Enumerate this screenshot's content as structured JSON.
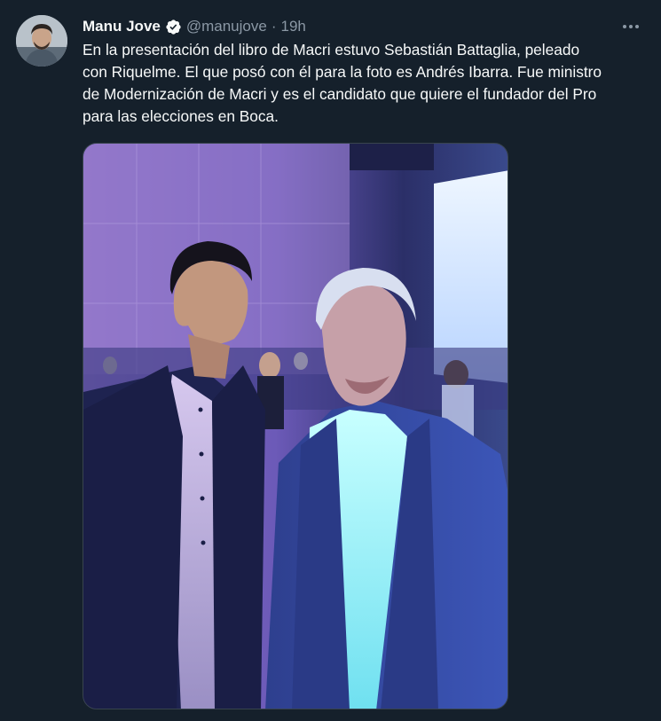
{
  "tweet": {
    "author_name": "Manu Jove",
    "verified": true,
    "handle": "@manujove",
    "separator": "·",
    "time": "19h",
    "text": "En la presentación del libro de Macri estuvo Sebastián Battaglia, peleado\ncon Riquelme. El que posó con él para la foto es Andrés Ibarra. Fue ministro\nde Modernización de Macri y es el candidato que quiere el fundador del Pro\npara las elecciones en Boca.",
    "more_icon": "more-horizontal-icon"
  },
  "colors": {
    "background": "#15202b",
    "text": "#f7f9f9",
    "secondary_text": "#8b98a5",
    "verified_badge": "#f7f9f9",
    "border": "#38444d"
  }
}
